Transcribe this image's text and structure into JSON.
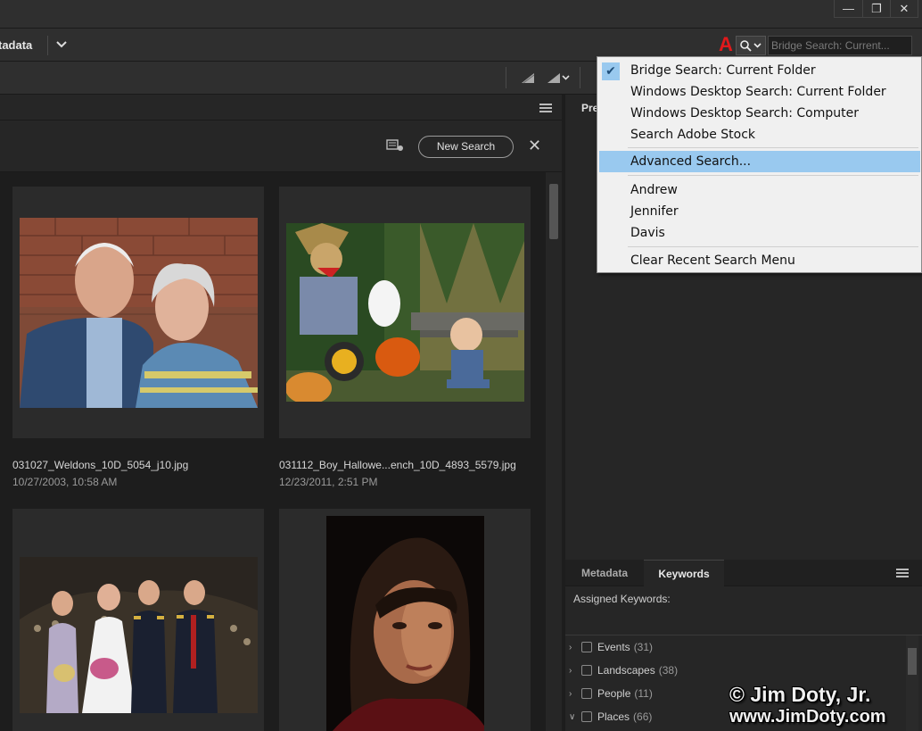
{
  "window": {
    "minimize": "—",
    "restore": "❐",
    "close": "✕"
  },
  "workspace": {
    "label": "tadata"
  },
  "search": {
    "annotation": "A",
    "placeholder": "Bridge Search: Current..."
  },
  "content": {
    "new_search_label": "New Search",
    "close_glyph": "✕",
    "items": [
      {
        "filename": "031027_Weldons_10D_5054_j10.jpg",
        "date": "10/27/2003, 10:58 AM"
      },
      {
        "filename": "031112_Boy_Hallowe...ench_10D_4893_5579.jpg",
        "date": "12/23/2011, 2:51 PM"
      },
      {
        "filename": "",
        "date": ""
      },
      {
        "filename": "",
        "date": ""
      }
    ]
  },
  "preview": {
    "tab_label": "Pre"
  },
  "bottom_panel": {
    "tabs": [
      "Metadata",
      "Keywords"
    ],
    "active_tab": "Keywords",
    "assigned_label": "Assigned Keywords:",
    "keywords": [
      {
        "name": "Events",
        "count": "(31)",
        "expanded": false
      },
      {
        "name": "Landscapes",
        "count": "(38)",
        "expanded": false
      },
      {
        "name": "People",
        "count": "(11)",
        "expanded": false
      },
      {
        "name": "Places",
        "count": "(66)",
        "expanded": true
      }
    ]
  },
  "search_menu": {
    "items": [
      {
        "label": "Bridge Search: Current Folder",
        "checked": true
      },
      {
        "label": "Windows Desktop Search: Current Folder",
        "checked": false
      },
      {
        "label": "Windows Desktop Search: Computer",
        "checked": false
      },
      {
        "label": "Search Adobe Stock",
        "checked": false
      },
      {
        "label": "Advanced Search...",
        "highlighted": true
      },
      {
        "label": "Andrew"
      },
      {
        "label": "Jennifer"
      },
      {
        "label": "Davis"
      },
      {
        "label": "Clear Recent Search Menu"
      }
    ]
  },
  "watermark": {
    "line1": "© Jim Doty, Jr.",
    "line2": "www.JimDoty.com"
  },
  "colors": {
    "annotation_red": "#e1191b",
    "menu_highlight": "#99c9ef",
    "panel_bg": "#262626"
  }
}
